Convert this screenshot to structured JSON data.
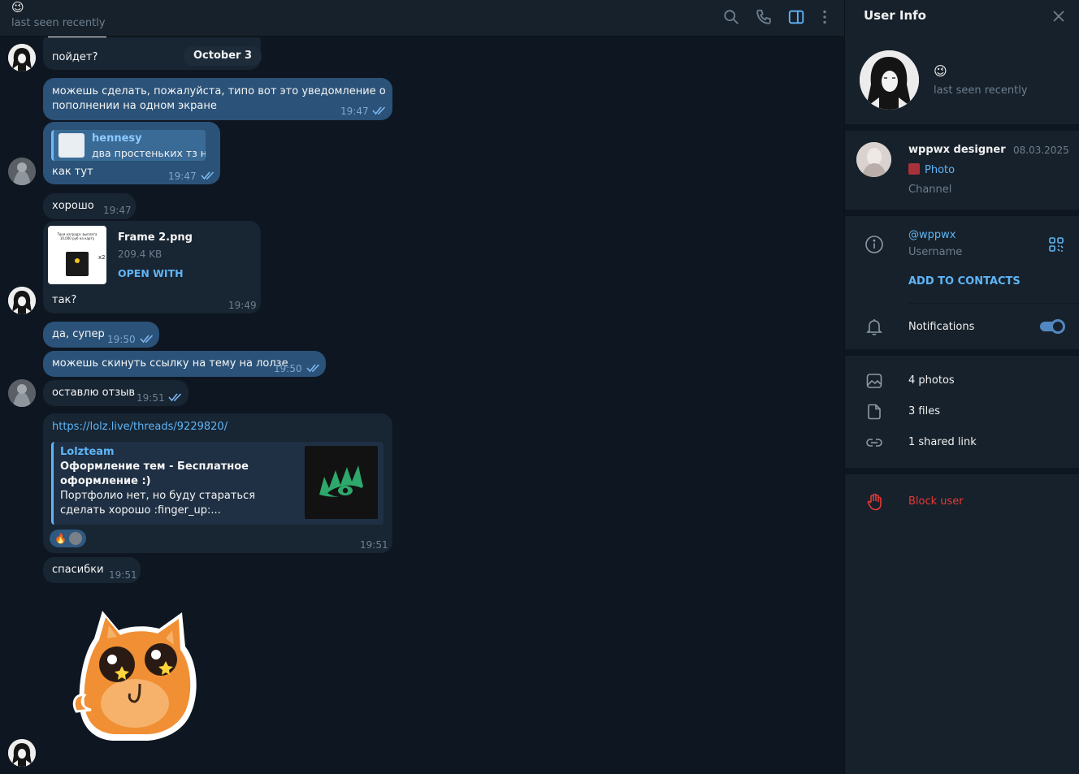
{
  "header": {
    "emoji": "😉",
    "status": "last seen recently"
  },
  "chat": {
    "date_pill": "October 3",
    "messages": [
      {
        "id": "m1",
        "dir": "in",
        "text": "пойдет?",
        "time": ""
      },
      {
        "id": "m2",
        "dir": "out",
        "text_line1": "можешь сделать, пожалуйста, типо вот это уведомление о",
        "text_line2": "пополнении на одном экране",
        "time": "19:47"
      },
      {
        "id": "m3",
        "dir": "out",
        "reply_name": "hennesy",
        "reply_text": "два простеньких тз н...",
        "text": "как тут",
        "time": "19:47"
      },
      {
        "id": "m4",
        "dir": "in",
        "text": "хорошо",
        "time": "19:47"
      },
      {
        "id": "m5",
        "dir": "in",
        "file_name": "Frame 2.png",
        "file_size": "209.4 KB",
        "file_action": "OPEN WITH",
        "text": "так?",
        "time": "19:49"
      },
      {
        "id": "m6",
        "dir": "out",
        "text": "да, супер",
        "time": "19:50"
      },
      {
        "id": "m7",
        "dir": "out",
        "text": "можешь скинуть ссылку на тему на лолзе",
        "time": "19:50"
      },
      {
        "id": "m8",
        "dir": "in",
        "text": "оставлю отзыв",
        "time": "19:51"
      },
      {
        "id": "m9",
        "dir": "in",
        "link": "https://lolz.live/threads/9229820/",
        "preview_site": "Lolzteam",
        "preview_title": "Оформление тем - Бесплатное оформление :)",
        "preview_desc": "Портфолио нет, но буду стараться сделать хорошо :finger_up:...",
        "reaction": "🔥",
        "time": "19:51"
      },
      {
        "id": "m10",
        "dir": "in",
        "text": "спасибки",
        "time": "19:51"
      }
    ],
    "file_thumb_text": "Твоя награда: выплата 10,000 руб на карту",
    "file_thumb_badge": "x2"
  },
  "panel": {
    "title": "User Info",
    "profile_emoji": "😉",
    "profile_status": "last seen recently",
    "channel": {
      "name": "wppwx designer",
      "date": "08.03.2025",
      "last_message": "Photo",
      "type": "Channel"
    },
    "username": "@wppwx",
    "username_caption": "Username",
    "add_contacts": "ADD TO CONTACTS",
    "notifications": "Notifications",
    "notifications_on": true,
    "photos": "4 photos",
    "files": "3 files",
    "links": "1 shared link",
    "block": "Block user"
  },
  "colors": {
    "background": "#0e1621",
    "panel": "#17212b",
    "incoming": "#182533",
    "outgoing": "#2b5278",
    "accent": "#5eb5f7",
    "danger": "#e53935"
  },
  "icons": [
    "search-icon",
    "phone-icon",
    "sidebar-toggle-icon",
    "more-vert-icon",
    "close-icon",
    "info-icon",
    "qr-code-icon",
    "bell-icon",
    "photo-icon",
    "file-icon",
    "link-icon",
    "block-hand-icon"
  ]
}
